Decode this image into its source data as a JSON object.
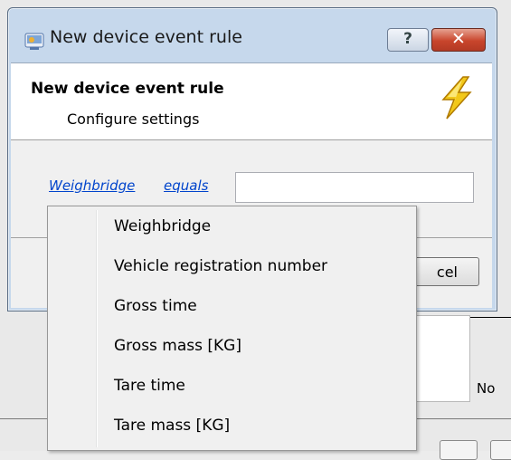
{
  "dialog": {
    "window_title": "New device event rule",
    "help_button": "?",
    "close_button": "✕",
    "header_title": "New device event rule",
    "header_subtitle": "Configure settings",
    "condition": {
      "field_link": "Weighbridge",
      "operator_link": "equals",
      "value": ""
    },
    "cancel_label_visible": "cel"
  },
  "background": {
    "partial_text": "No"
  },
  "menu": {
    "items": [
      {
        "label": "Weighbridge"
      },
      {
        "label": "Vehicle registration number"
      },
      {
        "label": "Gross time"
      },
      {
        "label": "Gross mass [KG]"
      },
      {
        "label": "Tare time"
      },
      {
        "label": "Tare mass [KG]"
      }
    ]
  },
  "colors": {
    "link": "#0044cc",
    "title_bar": "#c6d8ec",
    "close_button": "#c9452c",
    "bolt": "#f2c81a"
  },
  "icons": {
    "app": "device-rule-icon",
    "header": "lightning-bolt-icon"
  }
}
